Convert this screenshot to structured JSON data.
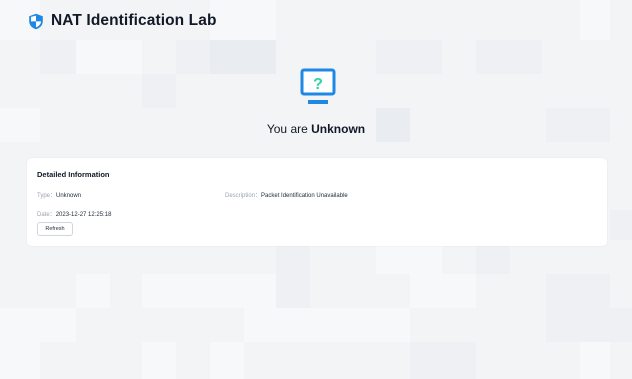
{
  "app": {
    "title": "NAT Identification Lab",
    "logo_icon": "shield-icon"
  },
  "status": {
    "prefix": "You are ",
    "value": "Unknown",
    "icon": "monitor-question-icon"
  },
  "details": {
    "title": "Detailed Information",
    "type_label": "Type：",
    "type_value": "Unknown",
    "description_label": "Description：",
    "description_value": "Packet Identification Unavailable",
    "date_label": "Date：",
    "date_value": "2023-12-27 12:25:18",
    "refresh_label": "Refresh"
  },
  "colors": {
    "accent": "#1e88e5",
    "question": "#2bd4a4",
    "panel": "#ffffff",
    "background": "#f3f4f6"
  }
}
